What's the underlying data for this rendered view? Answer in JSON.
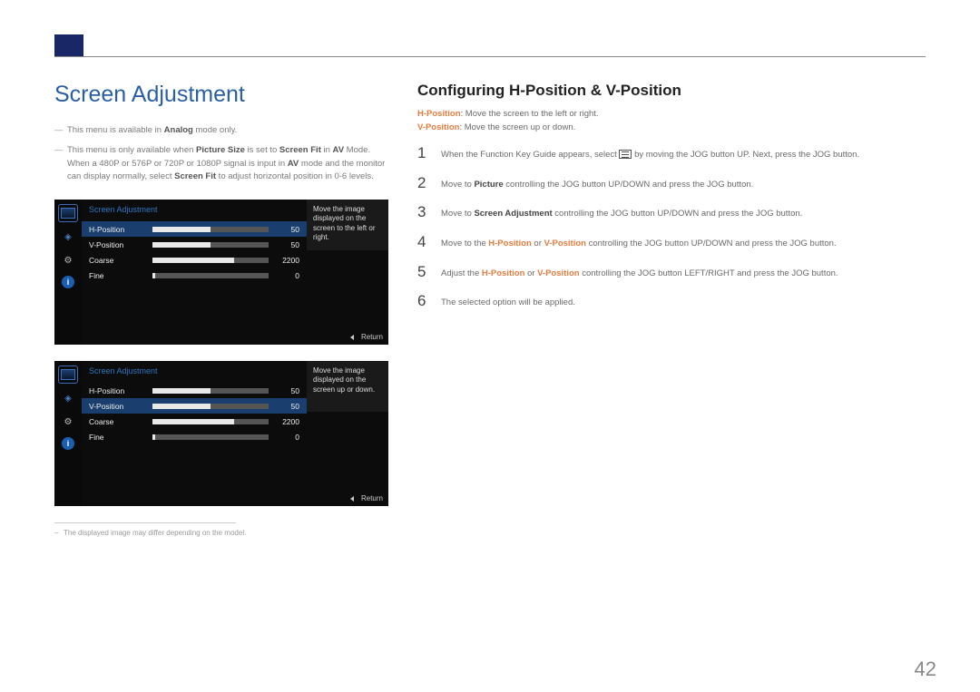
{
  "header": {
    "section_title": "Screen Adjustment",
    "subsection_title": "Configuring H-Position & V-Position"
  },
  "notes": {
    "n1_pre": "This menu is available in ",
    "n1_bold": "Analog",
    "n1_post": " mode only.",
    "n2_pre": "This menu is only available when ",
    "n2_b1": "Picture Size",
    "n2_mid1": " is set to ",
    "n2_b2": "Screen Fit",
    "n2_mid2": " in ",
    "n2_b3": "AV",
    "n2_mid3": " Mode. When a 480P or 576P or 720P or 1080P signal is input in ",
    "n2_b4": "AV",
    "n2_mid4": " mode and the monitor can display normally, select ",
    "n2_b5": "Screen Fit",
    "n2_post": " to adjust horizontal position in 0-6 levels."
  },
  "descriptions": {
    "d1_label": "H-Position",
    "d1_text": ": Move the screen to the left or right.",
    "d2_label": "V-Position",
    "d2_text": ": Move the screen up or down."
  },
  "steps": {
    "s1_num": "1",
    "s1_pre": "When the Function Key Guide appears, select ",
    "s1_post": " by moving the JOG button UP. Next, press the JOG button.",
    "s2_num": "2",
    "s2_pre": "Move to ",
    "s2_b": "Picture",
    "s2_post": " controlling the JOG button UP/DOWN and press the JOG button.",
    "s3_num": "3",
    "s3_pre": "Move to ",
    "s3_b": "Screen Adjustment",
    "s3_post": " controlling the JOG button UP/DOWN and press the JOG button.",
    "s4_num": "4",
    "s4_pre": "Move to the ",
    "s4_o1": "H-Position",
    "s4_mid": " or ",
    "s4_o2": "V-Position",
    "s4_post": " controlling the JOG button UP/DOWN and press the JOG button.",
    "s5_num": "5",
    "s5_pre": "Adjust the ",
    "s5_o1": "H-Position",
    "s5_mid": " or ",
    "s5_o2": "V-Position",
    "s5_post": " controlling the JOG button LEFT/RIGHT and press the JOG button.",
    "s6_num": "6",
    "s6_text": "The selected option will be applied."
  },
  "osd": {
    "title": "Screen Adjustment",
    "rows": {
      "r1_label": "H-Position",
      "r1_value": "50",
      "r2_label": "V-Position",
      "r2_value": "50",
      "r3_label": "Coarse",
      "r3_value": "2200",
      "r4_label": "Fine",
      "r4_value": "0"
    },
    "tooltip1": "Move the image displayed on the screen to the left or right.",
    "tooltip2": "Move the image displayed on the screen up or down.",
    "return_label": "Return"
  },
  "footnote": "The displayed image may differ depending on the model.",
  "page_number": "42"
}
